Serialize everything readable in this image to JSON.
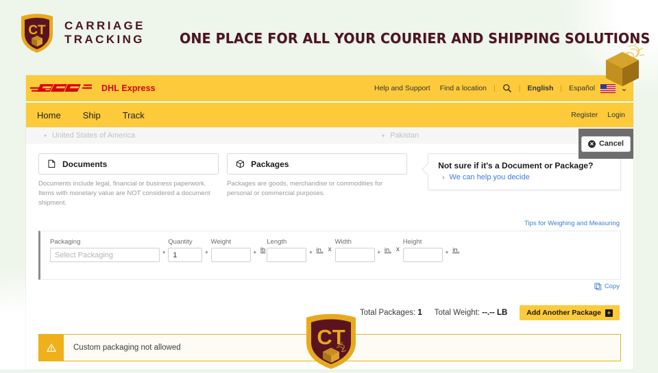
{
  "brand": {
    "line1": "CARRIAGE",
    "line2": "TRACKING",
    "logo_text": "CT",
    "tagline": "ONE PLACE FOR ALL YOUR COURIER AND SHIPPING SOLUTIONS",
    "colors": {
      "shield_dark": "#5a1420",
      "shield_gold": "#e8a91c",
      "tagline": "#4a1420"
    }
  },
  "dhl_header": {
    "logo_alt": "DHL",
    "product": "DHL Express",
    "help": "Help and Support",
    "find_location": "Find a location",
    "search_icon": "search-icon",
    "lang_en": "English",
    "lang_es": "Español",
    "divider": "|",
    "flag_alt": "United States flag",
    "chevron": "⌄",
    "colors": {
      "yellow": "#fcca3b",
      "red": "#d40511"
    }
  },
  "nav": {
    "items": [
      "Home",
      "Ship",
      "Track"
    ],
    "register": "Register",
    "login": "Login"
  },
  "country_row": {
    "from_value": "United States of America",
    "to_value": "Pakistan",
    "caret": "▾"
  },
  "cancel": {
    "label": "Cancel",
    "icon": "close-circle-icon",
    "glyph": "✕"
  },
  "shipment_type": {
    "documents": {
      "label": "Documents",
      "icon": "document-icon",
      "description": "Documents include legal, financial or business paperwork. Items with monetary value are NOT considered a document shipment."
    },
    "packages": {
      "label": "Packages",
      "icon": "package-box-icon",
      "description": "Packages are goods, merchandise or commodities for personal or commercial purposes."
    }
  },
  "help_card": {
    "title": "Not sure if it's a Document or Package?",
    "link": "We can help you decide",
    "arrow": "›"
  },
  "tips_link": "Tips for Weighing and Measuring",
  "package_form": {
    "packaging": {
      "label": "Packaging",
      "placeholder": "Select Packaging",
      "value": "",
      "required": "*"
    },
    "quantity": {
      "label": "Quantity",
      "value": "1",
      "required": "*"
    },
    "weight": {
      "label": "Weight",
      "value": "",
      "required": "*",
      "unit": "lb"
    },
    "length": {
      "label": "Length",
      "value": "",
      "required": "*",
      "unit": "in."
    },
    "width": {
      "label": "Width",
      "value": "",
      "required": "*",
      "unit": "in."
    },
    "height": {
      "label": "Height",
      "value": "",
      "required": "*",
      "unit": "in."
    },
    "times": "x",
    "copy": {
      "label": "Copy",
      "icon": "copy-icon"
    }
  },
  "totals": {
    "packages_label": "Total Packages:",
    "packages_value": "1",
    "weight_label": "Total Weight:",
    "weight_value": "--.-- LB",
    "add_button": "Add Another Package",
    "add_icon": "plus-icon",
    "add_glyph": "+"
  },
  "alert": {
    "icon": "warning-triangle-icon",
    "glyph": "!",
    "message": "Custom packaging not allowed",
    "colors": {
      "border": "#e8b21a",
      "icon_bg": "#efb01c",
      "bg": "#fcfbf4"
    }
  },
  "watermark": {
    "text": "CT",
    "name": "carriage-tracking-watermark"
  }
}
